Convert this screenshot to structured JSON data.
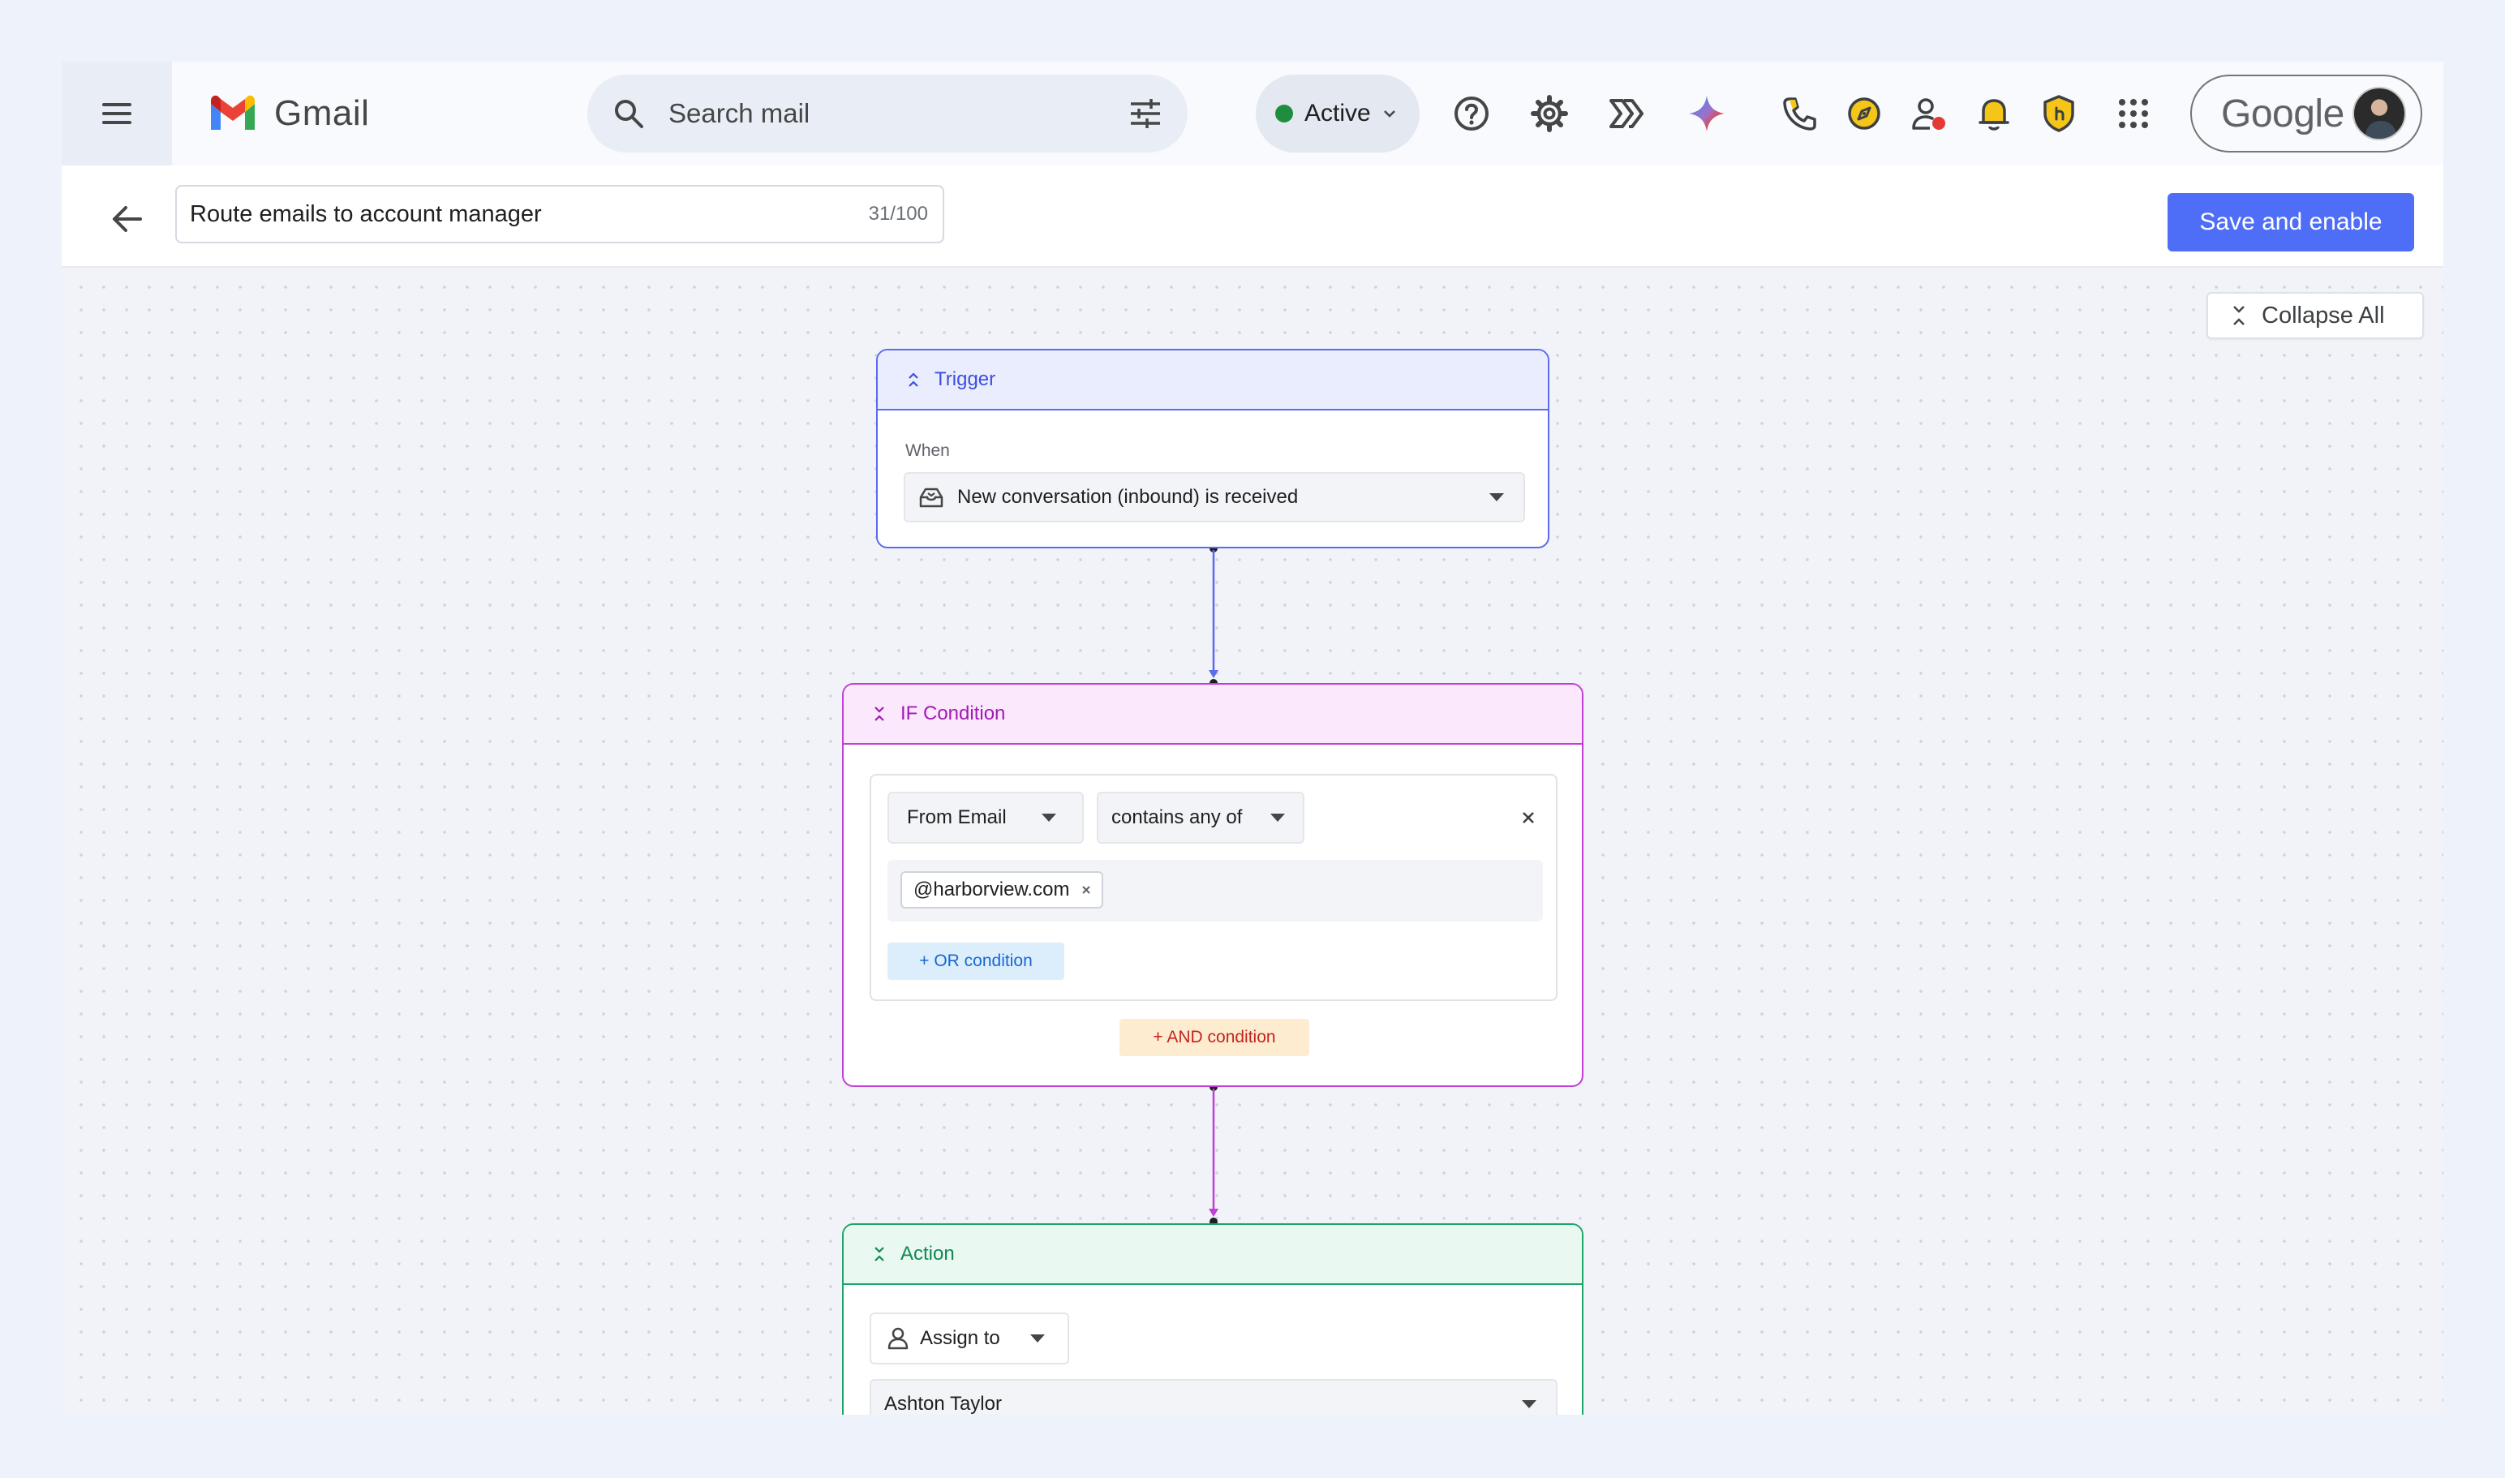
{
  "header": {
    "app_name": "Gmail",
    "search_placeholder": "Search mail",
    "status_label": "Active",
    "account_brand": "Google",
    "icons": [
      "main-menu-icon",
      "gmail-logo",
      "search-icon",
      "search-options-icon",
      "chevron-down-icon",
      "help-icon",
      "settings-icon",
      "workflow-icon",
      "gemini-icon",
      "phone-icon",
      "compass-icon",
      "contacts-icon",
      "bell-icon",
      "shield-icon",
      "apps-grid-icon"
    ]
  },
  "toolbar": {
    "workflow_name": "Route emails to account manager",
    "name_counter": "31/100",
    "save_label": "Save and enable"
  },
  "canvas": {
    "collapse_all_label": "Collapse All"
  },
  "trigger": {
    "title": "Trigger",
    "when_label": "When",
    "event": "New conversation (inbound) is received"
  },
  "condition": {
    "title": "IF Condition",
    "field": "From Email",
    "operator": "contains any of",
    "values": [
      "@harborview.com"
    ],
    "or_label": "+ OR condition",
    "and_label": "+ AND condition"
  },
  "action": {
    "title": "Action",
    "type": "Assign to",
    "assignee": "Ashton Taylor"
  },
  "colors": {
    "primary_button": "#4f6ef7",
    "trigger_accent": "#5b6bf0",
    "condition_accent": "#c23fd6",
    "action_accent": "#1ea56a",
    "status_active": "#1e8e3e"
  }
}
